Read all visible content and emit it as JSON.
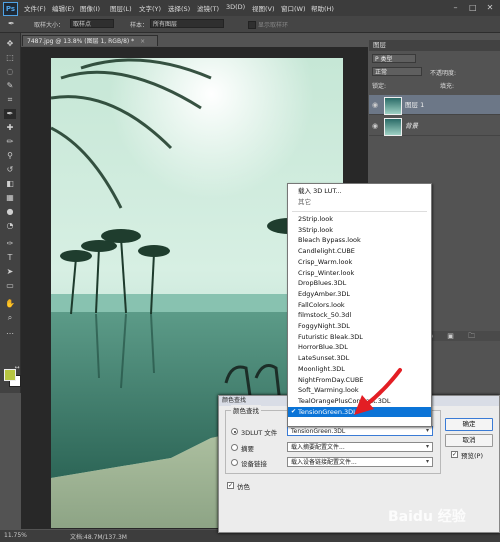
{
  "app": {
    "logo": "Ps"
  },
  "menubar": {
    "items": [
      "文件(F)",
      "编辑(E)",
      "图像(I)",
      "图层(L)",
      "文字(Y)",
      "选择(S)",
      "滤镜(T)",
      "3D(D)",
      "视图(V)",
      "窗口(W)",
      "帮助(H)"
    ],
    "window_controls": [
      "–",
      "□",
      "✕"
    ]
  },
  "options_bar": {
    "size_label": "取样大小：",
    "size_value": "取样点",
    "sample_label": "样本：",
    "sample_value": "所有图层",
    "show_ring_label": "显示取样环"
  },
  "document": {
    "tab_title": "7487.jpg @ 13.8% (图层 1, RGB/8) *",
    "tab_close": "×"
  },
  "status": {
    "zoom": "11.75%",
    "doc_size": "文档:48.7M/137.3M"
  },
  "layers_panel": {
    "tab": "图层",
    "kind_label": "P 类型",
    "blend_mode": "正常",
    "opacity_label": "不透明度:",
    "lock_label": "锁定:",
    "fill_label": "填充:",
    "layers": [
      {
        "name": "图层 1",
        "selected": true
      },
      {
        "name": "背景",
        "selected": false
      }
    ]
  },
  "dropdown": {
    "top_items": [
      "载入 3D LUT...",
      "其它"
    ],
    "items": [
      "2Strip.look",
      "3Strip.look",
      "Bleach Bypass.look",
      "Candlelight.CUBE",
      "Crisp_Warm.look",
      "Crisp_Winter.look",
      "DropBlues.3DL",
      "EdgyAmber.3DL",
      "FallColors.look",
      "filmstock_50.3dl",
      "FoggyNight.3DL",
      "Futuristic Bleak.3DL",
      "HorrorBlue.3DL",
      "LateSunset.3DL",
      "Moonlight.3DL",
      "NightFromDay.CUBE",
      "Soft_Warming.look",
      "TealOrangePlusContrast.3DL",
      "TensionGreen.3DL"
    ],
    "selected": "TensionGreen.3DL"
  },
  "dialog": {
    "title": "颜色查找",
    "group_label": "颜色查找",
    "lut_label": "3DLUT 文件",
    "lut_value": "TensionGreen.3DL",
    "abstract_label": "摘要",
    "abstract_value": "载入摘要配置文件...",
    "device_label": "设备链接",
    "device_value": "载入设备链接配置文件...",
    "dither_label": "仿色",
    "ok_label": "确定",
    "cancel_label": "取消",
    "preview_label": "预览(P)"
  },
  "colors": {
    "foreground": "#b7c642",
    "background": "#ffffff",
    "selection": "#0b74d7",
    "arrow": "#e31e24"
  },
  "watermark": {
    "text": "Baidu 经验"
  }
}
